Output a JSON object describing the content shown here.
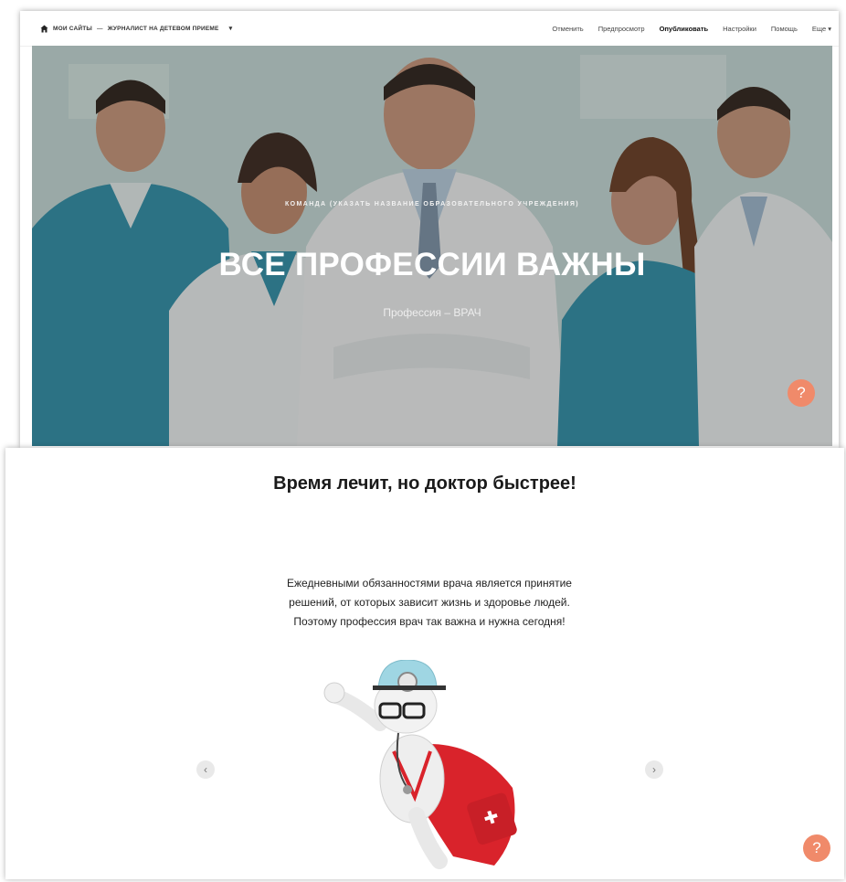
{
  "topbar": {
    "breadcrumb_root": "МОИ САЙТЫ",
    "breadcrumb_separator": "—",
    "breadcrumb_site": "ЖУРНАЛИСТ НА ДЕТЕВОМ ПРИЕМЕ",
    "actions": {
      "cancel": "Отменить",
      "preview": "Предпросмотр",
      "publish": "Опубликовать",
      "settings": "Настройки",
      "help": "Помощь",
      "more": "Еще"
    }
  },
  "hero": {
    "kicker": "КОМАНДА (УКАЗАТЬ НАЗВАНИЕ ОБРАЗОВАТЕЛЬНОГО УЧРЕЖДЕНИЯ)",
    "title": "ВСЕ ПРОФЕССИИ ВАЖНЫ",
    "subtitle": "Профессия – ВРАЧ"
  },
  "section": {
    "heading": "Время лечит, но доктор быстрее!",
    "paragraph_lines": [
      "Ежедневными обязанностями врача является принятие",
      "решений, от которых зависит жизнь и здоровье людей.",
      "Поэтому профессия врач так важна и нужна сегодня!"
    ]
  },
  "help_glyph": "?",
  "icons": {
    "home": "home-icon",
    "more_caret": "chevron-down-icon",
    "prev": "chevron-left-icon",
    "next": "chevron-right-icon"
  },
  "colors": {
    "help_button": "#f08a6a",
    "scrub_teal": "#2f8fa8",
    "overlay": "#282828"
  }
}
